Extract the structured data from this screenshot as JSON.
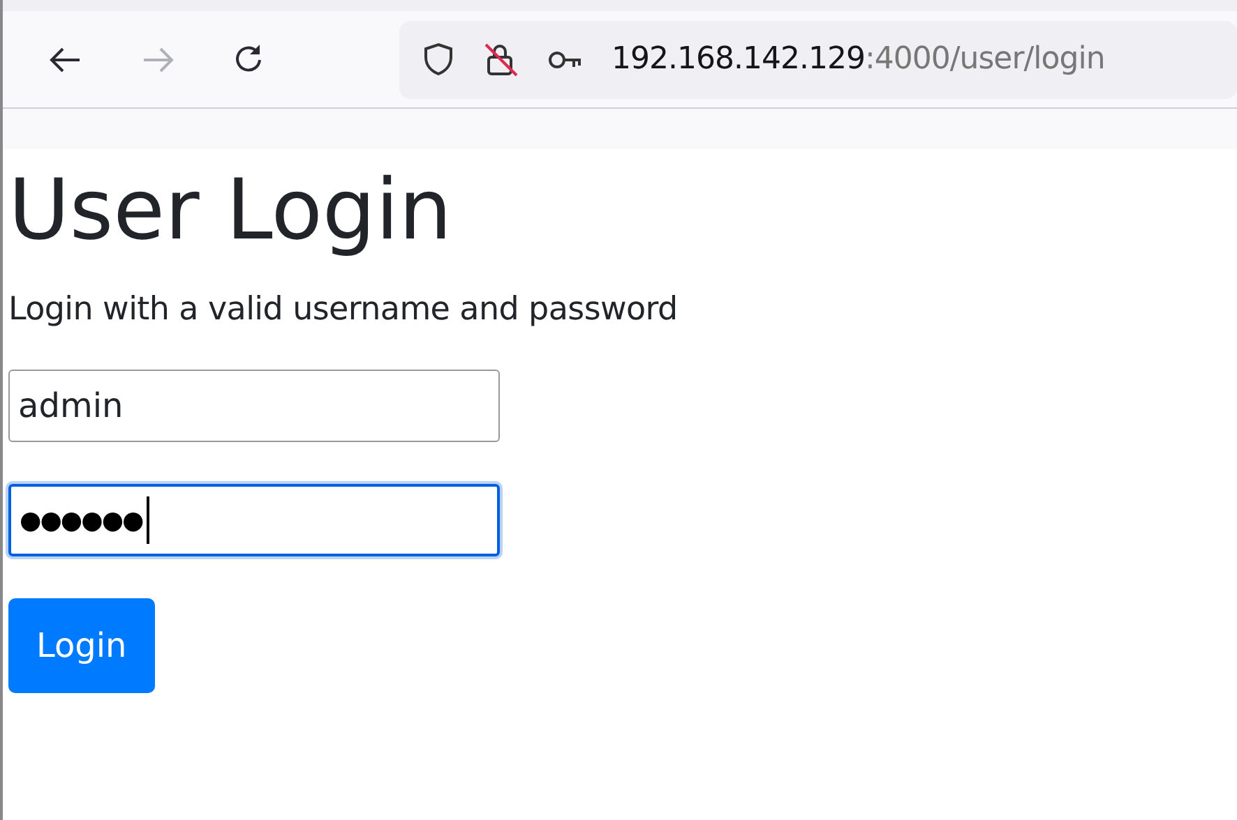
{
  "browser": {
    "back": {
      "disabled": false
    },
    "forward": {
      "disabled": true
    },
    "address": {
      "host": "192.168.142.129",
      "path": ":4000/user/login"
    }
  },
  "page": {
    "title": "User Login",
    "subtitle": "Login with a valid username and password",
    "fields": [
      {
        "kind": "text",
        "value": "admin",
        "focused": false
      },
      {
        "kind": "password",
        "value": "●●●●●●",
        "focused": true
      }
    ],
    "button": "Login"
  }
}
